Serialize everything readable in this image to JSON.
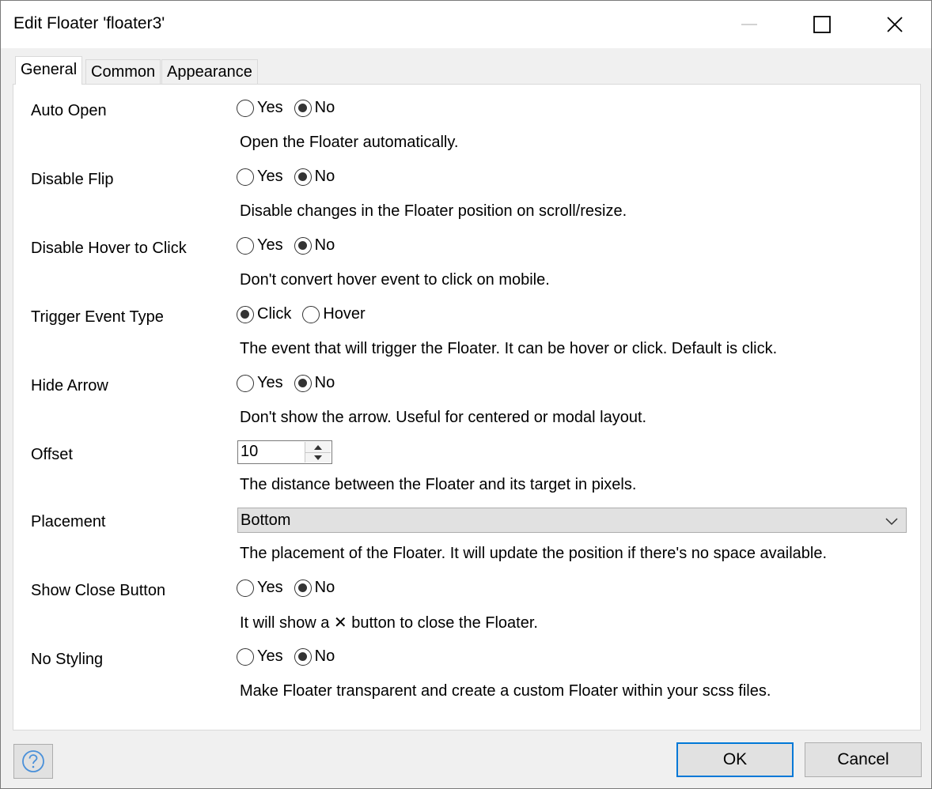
{
  "window": {
    "title": "Edit Floater 'floater3'"
  },
  "tabs": [
    {
      "label": "General",
      "active": true
    },
    {
      "label": "Common",
      "active": false
    },
    {
      "label": "Appearance",
      "active": false
    }
  ],
  "rows": {
    "auto_open": {
      "label": "Auto Open",
      "options": [
        "Yes",
        "No"
      ],
      "selected": "No",
      "description": "Open the Floater automatically."
    },
    "disable_flip": {
      "label": "Disable Flip",
      "options": [
        "Yes",
        "No"
      ],
      "selected": "No",
      "description": "Disable changes in the Floater position on scroll/resize."
    },
    "disable_hover": {
      "label": "Disable Hover to Click",
      "options": [
        "Yes",
        "No"
      ],
      "selected": "No",
      "description": "Don't convert hover event to click on mobile."
    },
    "trigger_event": {
      "label": "Trigger Event Type",
      "options": [
        "Click",
        "Hover"
      ],
      "selected": "Click",
      "description": "The event that will trigger the Floater. It can be hover or click. Default is click."
    },
    "hide_arrow": {
      "label": "Hide Arrow",
      "options": [
        "Yes",
        "No"
      ],
      "selected": "No",
      "description": "Don't show the arrow. Useful for centered or modal layout."
    },
    "offset": {
      "label": "Offset",
      "value": "10",
      "description": "The distance between the Floater and its target in pixels."
    },
    "placement": {
      "label": "Placement",
      "value": "Bottom",
      "description": "The placement of the Floater. It will update the position if there's no space available."
    },
    "show_close": {
      "label": "Show Close Button",
      "options": [
        "Yes",
        "No"
      ],
      "selected": "No",
      "description": "It will show a ✕ button to close the Floater."
    },
    "no_styling": {
      "label": "No Styling",
      "options": [
        "Yes",
        "No"
      ],
      "selected": "No",
      "description": "Make Floater transparent and create a custom Floater within your scss files."
    }
  },
  "footer": {
    "help_icon": "question-circle-icon",
    "ok_label": "OK",
    "cancel_label": "Cancel"
  },
  "colors": {
    "accent": "#0078d7",
    "button_bg": "#e1e1e1",
    "dialog_bg": "#f0f0f0"
  }
}
